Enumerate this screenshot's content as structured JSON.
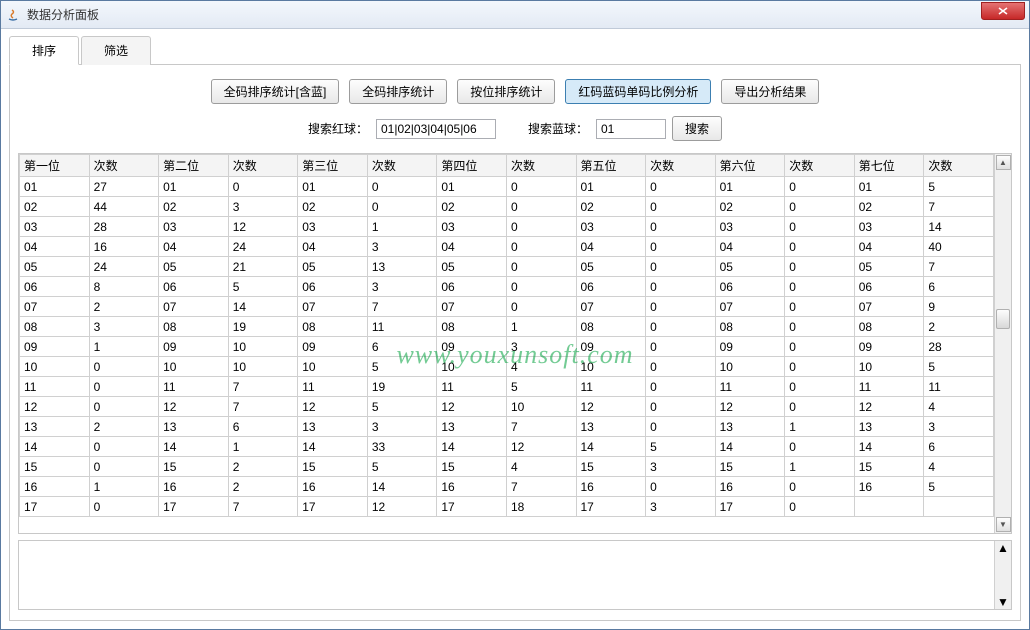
{
  "window": {
    "title": "数据分析面板"
  },
  "tabs": [
    {
      "label": "排序",
      "active": true
    },
    {
      "label": "筛选",
      "active": false
    }
  ],
  "toolbar": {
    "btn_full_with_blue": "全码排序统计[含蓝]",
    "btn_full": "全码排序统计",
    "btn_by_pos": "按位排序统计",
    "btn_ratio": "红码蓝码单码比例分析",
    "btn_export": "导出分析结果"
  },
  "search": {
    "red_label": "搜索红球：",
    "red_value": "01|02|03|04|05|06",
    "blue_label": "搜索蓝球：",
    "blue_value": "01",
    "btn": "搜索"
  },
  "table": {
    "headers": [
      "第一位",
      "次数",
      "第二位",
      "次数",
      "第三位",
      "次数",
      "第四位",
      "次数",
      "第五位",
      "次数",
      "第六位",
      "次数",
      "第七位",
      "次数"
    ],
    "rows": [
      [
        "01",
        "27",
        "01",
        "0",
        "01",
        "0",
        "01",
        "0",
        "01",
        "0",
        "01",
        "0",
        "01",
        "5"
      ],
      [
        "02",
        "44",
        "02",
        "3",
        "02",
        "0",
        "02",
        "0",
        "02",
        "0",
        "02",
        "0",
        "02",
        "7"
      ],
      [
        "03",
        "28",
        "03",
        "12",
        "03",
        "1",
        "03",
        "0",
        "03",
        "0",
        "03",
        "0",
        "03",
        "14"
      ],
      [
        "04",
        "16",
        "04",
        "24",
        "04",
        "3",
        "04",
        "0",
        "04",
        "0",
        "04",
        "0",
        "04",
        "40"
      ],
      [
        "05",
        "24",
        "05",
        "21",
        "05",
        "13",
        "05",
        "0",
        "05",
        "0",
        "05",
        "0",
        "05",
        "7"
      ],
      [
        "06",
        "8",
        "06",
        "5",
        "06",
        "3",
        "06",
        "0",
        "06",
        "0",
        "06",
        "0",
        "06",
        "6"
      ],
      [
        "07",
        "2",
        "07",
        "14",
        "07",
        "7",
        "07",
        "0",
        "07",
        "0",
        "07",
        "0",
        "07",
        "9"
      ],
      [
        "08",
        "3",
        "08",
        "19",
        "08",
        "11",
        "08",
        "1",
        "08",
        "0",
        "08",
        "0",
        "08",
        "2"
      ],
      [
        "09",
        "1",
        "09",
        "10",
        "09",
        "6",
        "09",
        "3",
        "09",
        "0",
        "09",
        "0",
        "09",
        "28"
      ],
      [
        "10",
        "0",
        "10",
        "10",
        "10",
        "5",
        "10",
        "4",
        "10",
        "0",
        "10",
        "0",
        "10",
        "5"
      ],
      [
        "11",
        "0",
        "11",
        "7",
        "11",
        "19",
        "11",
        "5",
        "11",
        "0",
        "11",
        "0",
        "11",
        "11"
      ],
      [
        "12",
        "0",
        "12",
        "7",
        "12",
        "5",
        "12",
        "10",
        "12",
        "0",
        "12",
        "0",
        "12",
        "4"
      ],
      [
        "13",
        "2",
        "13",
        "6",
        "13",
        "3",
        "13",
        "7",
        "13",
        "0",
        "13",
        "1",
        "13",
        "3"
      ],
      [
        "14",
        "0",
        "14",
        "1",
        "14",
        "33",
        "14",
        "12",
        "14",
        "5",
        "14",
        "0",
        "14",
        "6"
      ],
      [
        "15",
        "0",
        "15",
        "2",
        "15",
        "5",
        "15",
        "4",
        "15",
        "3",
        "15",
        "1",
        "15",
        "4"
      ],
      [
        "16",
        "1",
        "16",
        "2",
        "16",
        "14",
        "16",
        "7",
        "16",
        "0",
        "16",
        "0",
        "16",
        "5"
      ],
      [
        "17",
        "0",
        "17",
        "7",
        "17",
        "12",
        "17",
        "18",
        "17",
        "3",
        "17",
        "0",
        "",
        ""
      ]
    ]
  },
  "watermark": "www.youxunsoft.com"
}
